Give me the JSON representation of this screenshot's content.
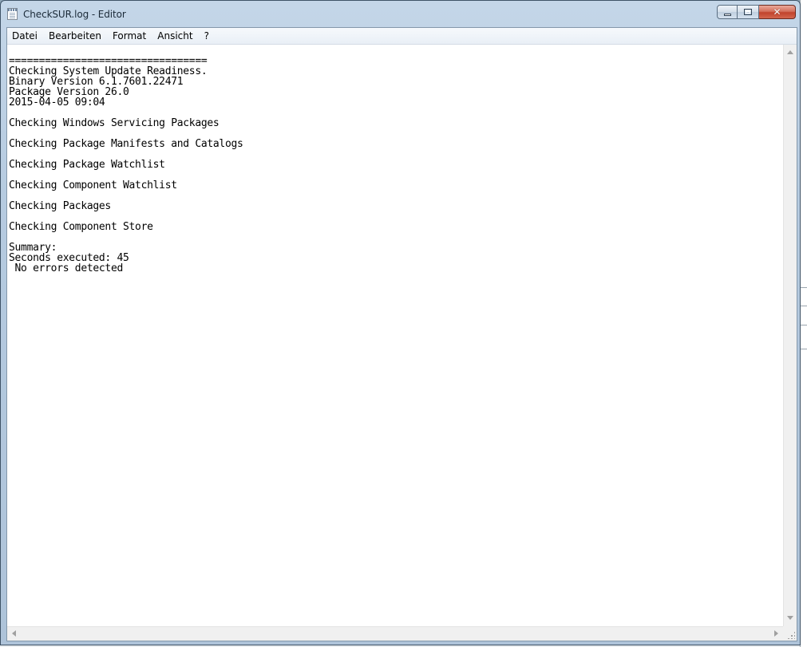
{
  "window": {
    "title": "CheckSUR.log - Editor",
    "icon": "notepad-icon",
    "caption": {
      "minimize_icon": "minimize-icon",
      "maximize_icon": "maximize-icon",
      "close_icon": "close-icon",
      "close_glyph": "✕"
    }
  },
  "menu": {
    "items": [
      {
        "label": "Datei"
      },
      {
        "label": "Bearbeiten"
      },
      {
        "label": "Format"
      },
      {
        "label": "Ansicht"
      },
      {
        "label": "?"
      }
    ]
  },
  "document": {
    "lines": [
      "=================================",
      "Checking System Update Readiness.",
      "Binary Version 6.1.7601.22471",
      "Package Version 26.0",
      "2015-04-05 09:04",
      "",
      "Checking Windows Servicing Packages",
      "",
      "Checking Package Manifests and Catalogs",
      "",
      "Checking Package Watchlist",
      "",
      "Checking Component Watchlist",
      "",
      "Checking Packages",
      "",
      "Checking Component Store",
      "",
      "Summary:",
      "Seconds executed: 45",
      " No errors detected"
    ]
  },
  "colors": {
    "titlebar": "#b6cbe0",
    "close_button": "#c1432c",
    "editor_background": "#ffffff"
  }
}
